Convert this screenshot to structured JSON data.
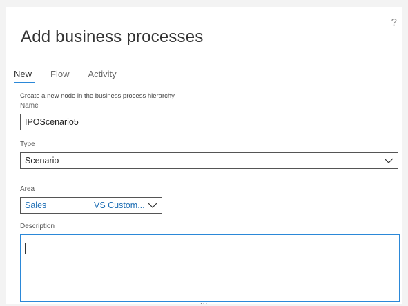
{
  "dialog": {
    "title": "Add business processes",
    "help_icon": "?"
  },
  "tabs": [
    {
      "label": "New",
      "active": true
    },
    {
      "label": "Flow",
      "active": false
    },
    {
      "label": "Activity",
      "active": false
    }
  ],
  "form": {
    "hint": "Create a new node in the business process hierarchy",
    "name": {
      "label": "Name",
      "value": "IPOScenario5"
    },
    "type": {
      "label": "Type",
      "value": "Scenario"
    },
    "area": {
      "label": "Area",
      "value_primary": "Sales",
      "value_secondary": "VS Custom..."
    },
    "description": {
      "label": "Description",
      "value": ""
    }
  },
  "footer": {
    "more": "..."
  },
  "colors": {
    "accent": "#2b88d8",
    "link": "#1f6fb5",
    "border": "#555555"
  }
}
